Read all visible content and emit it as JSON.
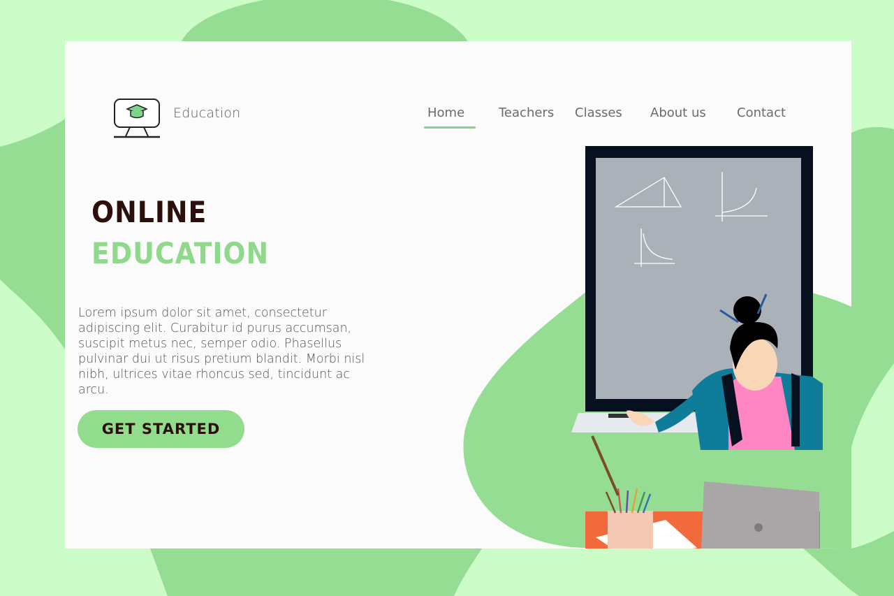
{
  "brand": {
    "name": "Education",
    "logo_icon": "monitor-graduation-cap-icon"
  },
  "nav": {
    "items": [
      {
        "label": "Home",
        "active": true
      },
      {
        "label": "Teachers",
        "active": false
      },
      {
        "label": "Classes",
        "active": false
      },
      {
        "label": "About us",
        "active": false
      },
      {
        "label": "Contact",
        "active": false
      }
    ]
  },
  "hero": {
    "title_line1": "ONLINE",
    "title_line2": "EDUCATION",
    "description": "Lorem ipsum dolor sit amet, consectetur adipiscing elit. Curabitur id purus accumsan, suscipit metus nec, semper odio. Phasellus pulvinar dui ut risus pretium blandit. Morbi nisl nibh, ultrices vitae rhoncus sed, tincidunt ac arcu.",
    "cta_label": "GET STARTED"
  },
  "colors": {
    "page_bg": "#ccfdc9",
    "blob": "#94dd93",
    "accent": "#8fd88c",
    "title_dark": "#2a0f0a",
    "board": "#abb1b9",
    "desk": "#f26a3b"
  }
}
